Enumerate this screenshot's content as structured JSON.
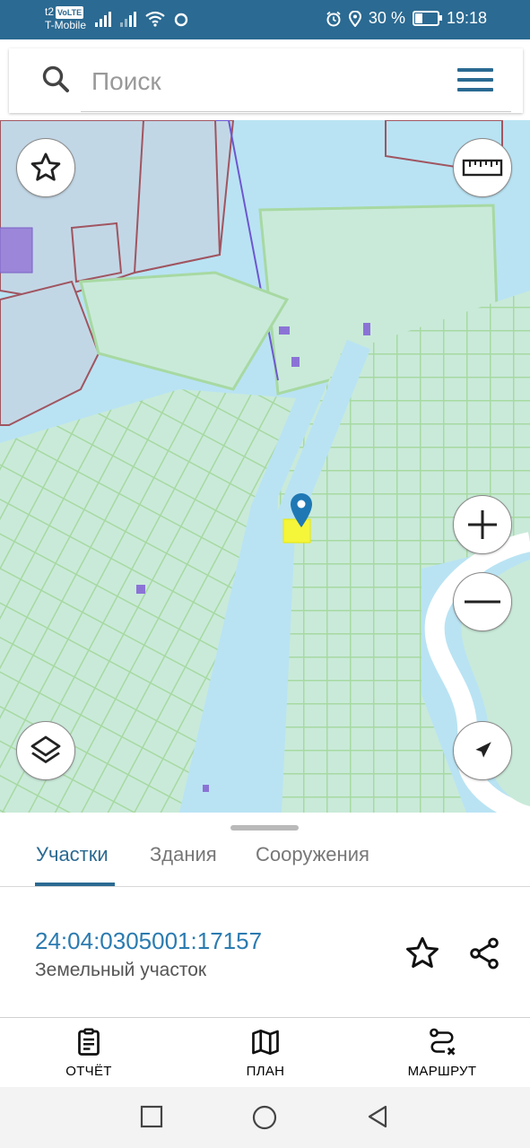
{
  "status_bar": {
    "carrier_line1": "t2",
    "carrier_volte": "VoLTE",
    "carrier_line2": "T-Mobile",
    "battery_text": "30 %",
    "battery_level": 0.3,
    "time": "19:18"
  },
  "search": {
    "placeholder": "Поиск"
  },
  "tabs": [
    {
      "label": "Участки",
      "active": true
    },
    {
      "label": "Здания",
      "active": false
    },
    {
      "label": "Сооружения",
      "active": false
    }
  ],
  "parcel": {
    "cadastral_number": "24:04:0305001:17157",
    "type": "Земельный участок"
  },
  "bottom_nav": [
    {
      "label": "ОТЧЁТ",
      "icon": "report-icon"
    },
    {
      "label": "ПЛАН",
      "icon": "map-icon"
    },
    {
      "label": "МАРШРУТ",
      "icon": "route-icon"
    }
  ],
  "colors": {
    "accent": "#2b6a92",
    "link": "#2b7bb0",
    "map_water": "#b9e3f3",
    "map_parcel_fill": "#c9ead9",
    "map_parcel_border": "#a7d9a2",
    "map_zone_border": "#a05560",
    "selected_parcel": "#f5f53a",
    "marker": "#1f78b4"
  }
}
